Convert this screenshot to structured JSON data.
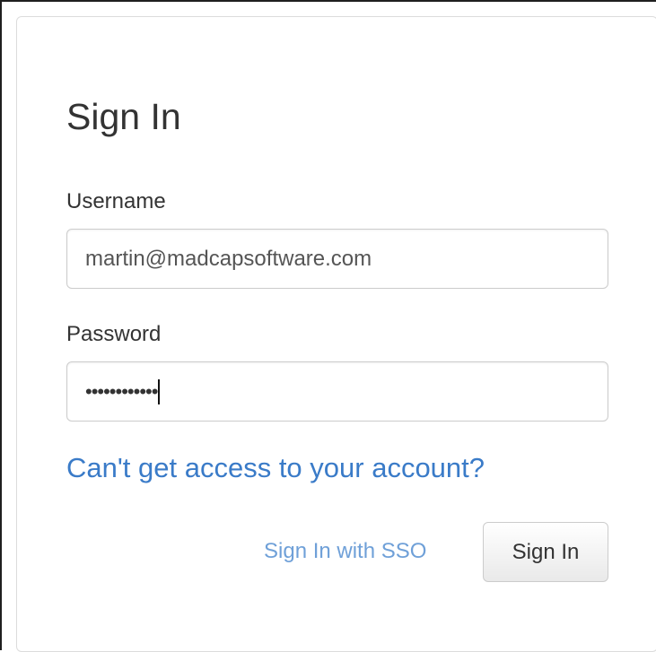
{
  "form": {
    "title": "Sign In",
    "username_label": "Username",
    "username_value": "martin@madcapsoftware.com",
    "password_label": "Password",
    "password_masked": "••••••••••••",
    "forgot_link": "Can't get access to your account?",
    "sso_link": "Sign In with SSO",
    "submit_label": "Sign In"
  },
  "colors": {
    "link": "#3a7bc8",
    "link_light": "#6fa0d8",
    "text": "#333333",
    "border": "#cccccc"
  }
}
